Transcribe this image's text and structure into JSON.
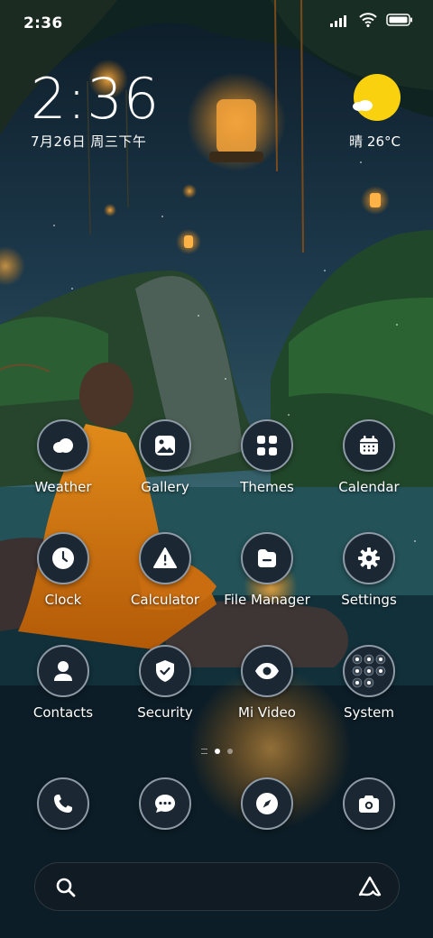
{
  "status_bar": {
    "time": "2:36",
    "icons": [
      "signal-icon",
      "wifi-icon",
      "battery-icon"
    ]
  },
  "clock_widget": {
    "time": "2:36",
    "date": "7月26日 周三下午"
  },
  "weather_widget": {
    "text": "晴 26°C",
    "icon": "sun-cloud-icon"
  },
  "apps": [
    {
      "label": "Weather",
      "icon": "weather-cloud-icon"
    },
    {
      "label": "Gallery",
      "icon": "gallery-icon"
    },
    {
      "label": "Themes",
      "icon": "themes-grid-icon"
    },
    {
      "label": "Calendar",
      "icon": "calendar-icon"
    },
    {
      "label": "Clock",
      "icon": "clock-icon"
    },
    {
      "label": "Calculator",
      "icon": "calculator-warning-icon"
    },
    {
      "label": "File Manager",
      "icon": "folder-icon"
    },
    {
      "label": "Settings",
      "icon": "gear-icon"
    },
    {
      "label": "Contacts",
      "icon": "contact-person-icon"
    },
    {
      "label": "Security",
      "icon": "shield-check-icon"
    },
    {
      "label": "Mi Video",
      "icon": "eye-icon"
    },
    {
      "label": "System",
      "icon": "folder-grid-icon"
    }
  ],
  "dock": [
    {
      "icon": "phone-icon"
    },
    {
      "icon": "messages-icon"
    },
    {
      "icon": "compass-icon"
    },
    {
      "icon": "camera-icon"
    }
  ],
  "page_indicator": {
    "pages": 2,
    "current": 1
  },
  "search_bar": {
    "left_icon": "search-icon",
    "right_icon": "assistant-icon"
  },
  "colors": {
    "sun": "#f9d10e",
    "icon_bg": "#1b2733",
    "icon_border": "#8e9aa6"
  }
}
